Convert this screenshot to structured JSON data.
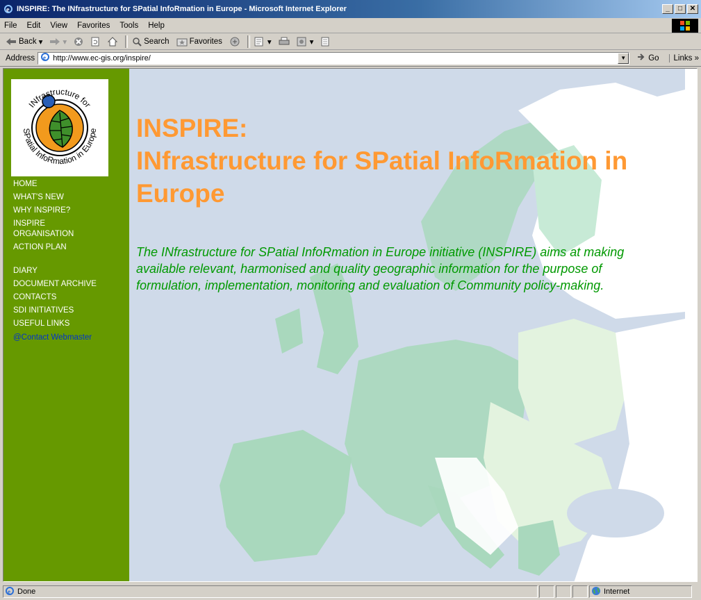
{
  "window": {
    "title": "INSPIRE: The INfrastructure for SPatial InfoRmation in Europe - Microsoft Internet Explorer",
    "minimize": "_",
    "maximize": "□",
    "close": "✕"
  },
  "menu": {
    "items": [
      {
        "label": "File"
      },
      {
        "label": "Edit"
      },
      {
        "label": "View"
      },
      {
        "label": "Favorites"
      },
      {
        "label": "Tools"
      },
      {
        "label": "Help"
      }
    ]
  },
  "toolbar": {
    "back_label": "Back",
    "search_label": "Search",
    "favorites_label": "Favorites"
  },
  "address": {
    "label": "Address",
    "url": "http://www.ec-gis.org/inspire/",
    "go_label": "Go",
    "links_label": "Links"
  },
  "sidebar": {
    "logo_text": {
      "top": "INfrastructure for",
      "bottom": "SPatial InfoRmation in Europe"
    },
    "nav_group_1": [
      {
        "label": "HOME"
      },
      {
        "label": "WHAT'S NEW"
      },
      {
        "label": "WHY INSPIRE?"
      },
      {
        "label": "INSPIRE ORGANISATION"
      },
      {
        "label": "ACTION PLAN"
      }
    ],
    "nav_group_2": [
      {
        "label": "DIARY"
      },
      {
        "label": "DOCUMENT ARCHIVE"
      },
      {
        "label": "CONTACTS"
      },
      {
        "label": "SDI INITIATIVES"
      },
      {
        "label": "USEFUL LINKS"
      }
    ],
    "webmaster_label": "@Contact Webmaster"
  },
  "main": {
    "headline_line1": "INSPIRE:",
    "headline_line2": "INfrastructure for SPatial InfoRmation in Europe",
    "intro": "The INfrastructure for SPatial InfoRmation in Europe initiative (INSPIRE) aims at making available relevant, harmonised and quality geographic information for the purpose of formulation, implementation, monitoring and evaluation of Community policy-making."
  },
  "status": {
    "text": "Done",
    "zone": "Internet"
  },
  "colors": {
    "sidebar": "#669900",
    "headline": "#ff9933",
    "intro": "#009900",
    "webmaster_link": "#0033cc",
    "sea": "#cfdae9",
    "land": "#a9d8bd"
  }
}
